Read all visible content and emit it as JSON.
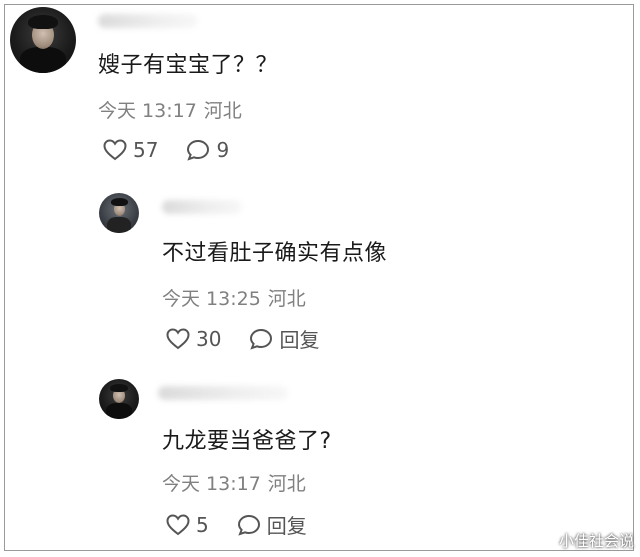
{
  "comments": [
    {
      "text": "嫂子有宝宝了？？",
      "time": "今天 13:17",
      "location": "河北",
      "likes": "57",
      "replies": "9"
    },
    {
      "text": "不过看肚子确实有点像",
      "time": "今天 13:25",
      "location": "河北",
      "likes": "30",
      "reply_label": "回复"
    },
    {
      "text": "九龙要当爸爸了?",
      "time": "今天 13:17",
      "location": "河北",
      "likes": "5",
      "reply_label": "回复"
    }
  ],
  "icons": [
    "heart-icon",
    "comment-bubble-icon"
  ],
  "watermark": "小佳社会说"
}
